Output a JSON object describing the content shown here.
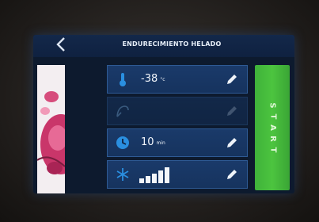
{
  "header": {
    "back_icon": "chevron-left-icon",
    "title": "ENDURECIMIENTO HELADO"
  },
  "program_image": {
    "description_icon": "product-photo"
  },
  "settings": [
    {
      "id": "temperature",
      "icon": "thermometer-icon",
      "value": "-38",
      "unit": "°c",
      "enabled": true
    },
    {
      "id": "probe",
      "icon": "core-probe-icon",
      "value": "",
      "unit": "",
      "enabled": false
    },
    {
      "id": "time",
      "icon": "clock-icon",
      "value": "10",
      "unit": "min",
      "enabled": true
    },
    {
      "id": "fan",
      "icon": "fan-snowflake-icon",
      "value": "",
      "unit": "",
      "fan_level": 5,
      "fan_level_max": 5,
      "enabled": true
    }
  ],
  "start_button": {
    "label": "START"
  },
  "colors": {
    "screen_bg": "#0d1a2e",
    "row_bg": "#1a3a6a",
    "accent_blue": "#2a8fe0",
    "start_green": "#46bb3c"
  }
}
